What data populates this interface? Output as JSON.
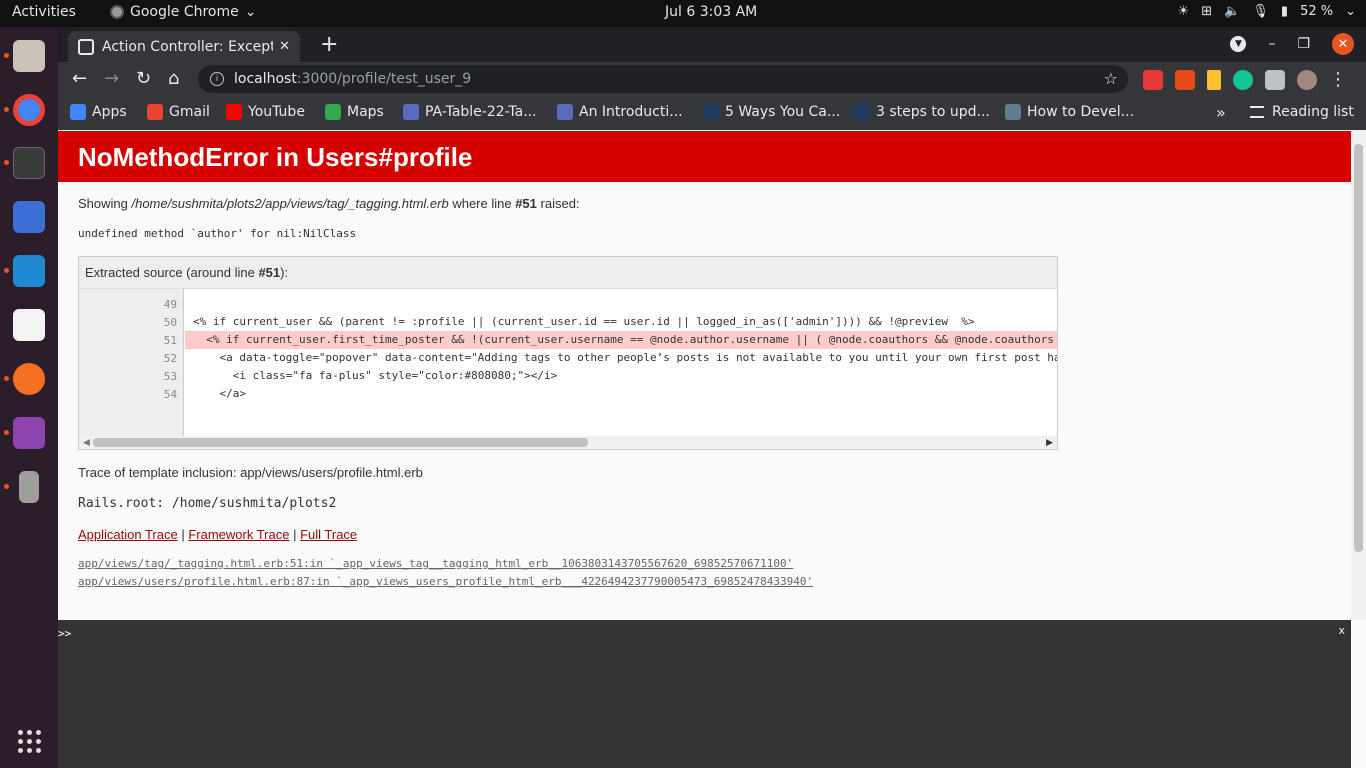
{
  "topbar": {
    "activities": "Activities",
    "app_name": "Google Chrome",
    "clock": "Jul 6  3:03 AM",
    "battery": "52 %"
  },
  "browser": {
    "tab_title": "Action Controller: Excepti",
    "url_host": "localhost",
    "url_path": ":3000/profile/test_user_9"
  },
  "bookmarks": [
    {
      "label": "Apps",
      "color": "#4285f4"
    },
    {
      "label": "Gmail",
      "color": "#ea4335"
    },
    {
      "label": "YouTube",
      "color": "#ff0000"
    },
    {
      "label": "Maps",
      "color": "#34a853"
    },
    {
      "label": "PA-Table-22-Ta...",
      "color": "#5c6bc0"
    },
    {
      "label": "An Introducti...",
      "color": "#5c6bc0"
    },
    {
      "label": "5 Ways You Ca...",
      "color": "#1e3a5f"
    },
    {
      "label": "3 steps to upd...",
      "color": "#1e3a5f"
    },
    {
      "label": "How to Devel...",
      "color": "#607d8b"
    }
  ],
  "reading_list": "Reading list",
  "error": {
    "title": "NoMethodError in Users#profile",
    "showing_prefix": "Showing ",
    "file": "/home/sushmita/plots2/app/views/tag/_tagging.html.erb",
    "where_line": " where line ",
    "line_no": "#51",
    "raised": " raised:",
    "message": "undefined method `author' for nil:NilClass",
    "extracted_prefix": "Extracted source (around line ",
    "extracted_line": "#51",
    "extracted_suffix": "):",
    "source_lines": [
      {
        "n": "49",
        "code": ""
      },
      {
        "n": "50",
        "code": "<% if current_user && (parent != :profile || (current_user.id == user.id || logged_in_as(['admin']))) && !@preview  %>"
      },
      {
        "n": "51",
        "code": "  <% if current_user.first_time_poster && !(current_user.username == @node.author.username || ( @node.coauthors && @node.coauthors"
      },
      {
        "n": "52",
        "code": "    <a data-toggle=\"popover\" data-content=\"Adding tags to other people’s posts is not available to you until your own first post ha"
      },
      {
        "n": "53",
        "code": "      <i class=\"fa fa-plus\" style=\"color:#808080;\"></i>"
      },
      {
        "n": "54",
        "code": "    </a>"
      }
    ],
    "trace_inclusion": "Trace of template inclusion: app/views/users/profile.html.erb",
    "rails_root": "Rails.root: /home/sushmita/plots2",
    "trace_links": [
      "Application Trace",
      "Framework Trace",
      "Full Trace"
    ],
    "trace_lines": [
      "app/views/tag/_tagging.html.erb:51:in `_app_views_tag__tagging_html_erb__1063803143705567620_69852570671100'",
      "app/views/users/profile.html.erb:87:in `_app_views_users_profile_html_erb___4226494237790005473_69852478433940'"
    ]
  },
  "console": {
    "prompt": ">>",
    "close": "x"
  }
}
